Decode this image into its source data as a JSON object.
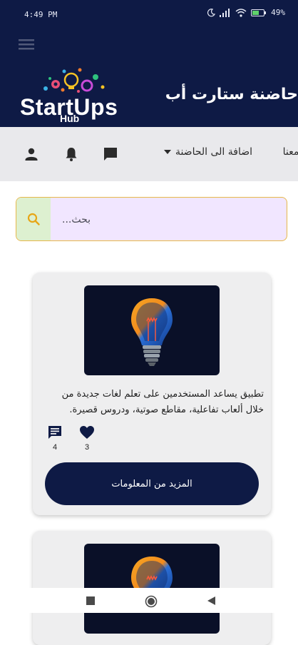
{
  "status_bar": {
    "time": "4:49 PM",
    "battery": "49%"
  },
  "header": {
    "logo_title": "StartUps",
    "logo_subtitle": "Hub",
    "app_title": "حاضنة ستارت أب"
  },
  "navbar": {
    "add_label": "اضافة الى الحاضنة",
    "about_label": "ل معنا",
    "icons": [
      "user-icon",
      "bell-icon",
      "message-icon",
      "dropdown-caret-icon"
    ]
  },
  "search": {
    "placeholder": "...بحث"
  },
  "cards": [
    {
      "description": "تطبيق يساعد المستخدمين على تعلم لغات جديدة من خلال ألعاب تفاعلية، مقاطع صوتية، ودروس قصيرة.",
      "comments": "4",
      "likes": "3",
      "more_label": "المزيد من المعلومات"
    }
  ],
  "colors": {
    "primary": "#0e1a45",
    "search_bg": "#f1e6ff",
    "search_button_bg": "#ddf0d0",
    "search_border": "#e7b84a",
    "bulb_orange": "#f28b1e",
    "bulb_blue": "#1f5fbf"
  }
}
